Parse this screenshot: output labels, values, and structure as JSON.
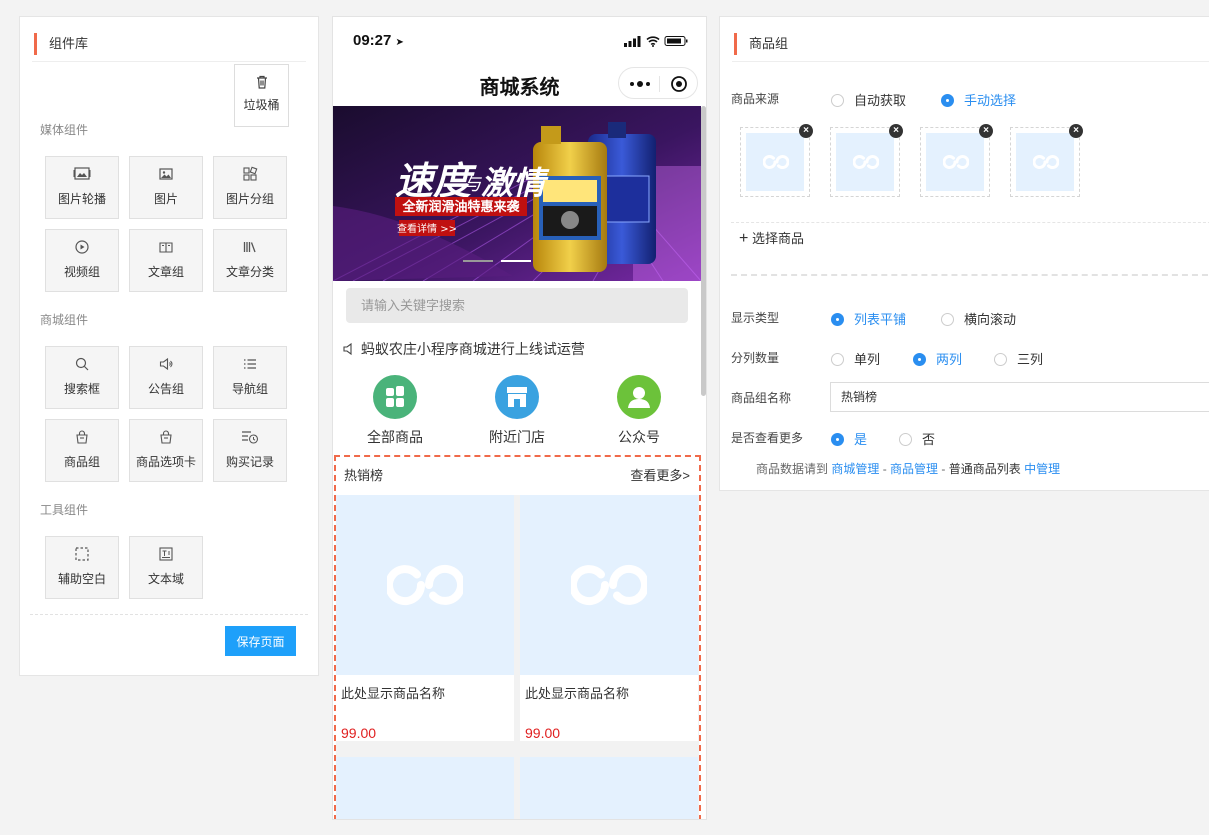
{
  "left_panel": {
    "title": "组件库",
    "trash_label": "垃圾桶",
    "sections": [
      {
        "label": "媒体组件",
        "items": [
          "图片轮播",
          "图片",
          "图片分组",
          "视频组",
          "文章组",
          "文章分类"
        ]
      },
      {
        "label": "商城组件",
        "items": [
          "搜索框",
          "公告组",
          "导航组",
          "商品组",
          "商品选项卡",
          "购买记录"
        ]
      },
      {
        "label": "工具组件",
        "items": [
          "辅助空白",
          "文本域"
        ]
      }
    ],
    "save_button": "保存页面"
  },
  "phone": {
    "time": "09:27",
    "title": "商城系统",
    "banner": {
      "title_big": "速度",
      "title_small": "与",
      "title_big2": "激情",
      "subtitle": "全新润滑油特惠来袭",
      "cta": "查看详情 >>"
    },
    "search_placeholder": "请输入关键字搜索",
    "notice": "蚂蚁农庄小程序商城进行上线试运营",
    "navs": [
      "全部商品",
      "附近门店",
      "公众号"
    ],
    "goods": {
      "title": "热销榜",
      "more": "查看更多>",
      "items": [
        {
          "name": "此处显示商品名称",
          "price": "99.00"
        },
        {
          "name": "此处显示商品名称",
          "price": "99.00"
        }
      ]
    }
  },
  "right_panel": {
    "title": "商品组",
    "source": {
      "label": "商品来源",
      "options": [
        "自动获取",
        "手动选择"
      ],
      "selected": "手动选择"
    },
    "select_goods": "选择商品",
    "display_type": {
      "label": "显示类型",
      "options": [
        "列表平铺",
        "横向滚动"
      ],
      "selected": "列表平铺"
    },
    "columns": {
      "label": "分列数量",
      "options": [
        "单列",
        "两列",
        "三列"
      ],
      "selected": "两列"
    },
    "group_name": {
      "label": "商品组名称",
      "value": "热销榜"
    },
    "show_more": {
      "label": "是否查看更多",
      "options": [
        "是",
        "否"
      ],
      "selected": "是"
    },
    "hint": {
      "prefix": "商品数据请到",
      "link1": "商城管理",
      "sep1": " - ",
      "link2": "商品管理",
      "sep2": " - ",
      "plain": "普通商品列表",
      "link3": "中管理"
    }
  },
  "colors": {
    "accent": "#f06a4a",
    "primary": "#2a8ef0",
    "save": "#1ea0fa",
    "price": "#e02020",
    "placeholder": "#e4f1fe"
  }
}
